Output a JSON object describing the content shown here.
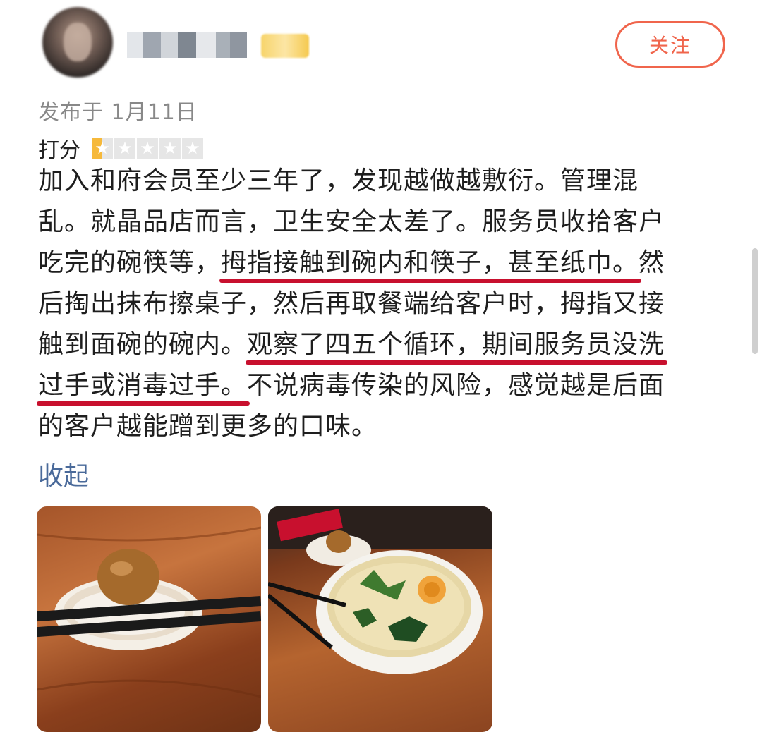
{
  "author": {
    "name_blurred": true
  },
  "follow_button": {
    "label": "关注"
  },
  "post_meta": {
    "published": "发布于 1月11日"
  },
  "rating": {
    "label": "打分",
    "stars_total": 5,
    "stars_value": 0.5,
    "star_color": "#f6b93b"
  },
  "review": {
    "lines": [
      [
        {
          "t": "加入和府会员至少三年了，发现越做越敷衍。管理混"
        }
      ],
      [
        {
          "t": "乱。就晶品店而言，卫生安全太差了。服务员收拾客户"
        }
      ],
      [
        {
          "t": "吃完的碗筷等，"
        },
        {
          "t": "拇指接触到碗内和筷子，甚至纸巾。",
          "u": true
        },
        {
          "t": "然"
        }
      ],
      [
        {
          "t": "后掏出抹布擦桌子，然后再取餐端给客户时，拇指又接"
        }
      ],
      [
        {
          "t": "触到面碗的碗内。"
        },
        {
          "t": "观察了四五个循环，期间服务员没洗",
          "u": true
        }
      ],
      [
        {
          "t": "过手或消毒过手。",
          "u": true
        },
        {
          "t": "不说病毒传染的风险，感觉越是后面"
        }
      ],
      [
        {
          "t": "的客户越能蹭到更多的口味。"
        }
      ]
    ],
    "underline_color": "#c8102e"
  },
  "collapse_link": {
    "label": "收起"
  },
  "photos": [
    {
      "alt": "soy egg on small dish with chopsticks"
    },
    {
      "alt": "ramen bowl with egg and greens"
    }
  ],
  "colors": {
    "accent": "#f0654c",
    "link": "#4a6a9a"
  }
}
